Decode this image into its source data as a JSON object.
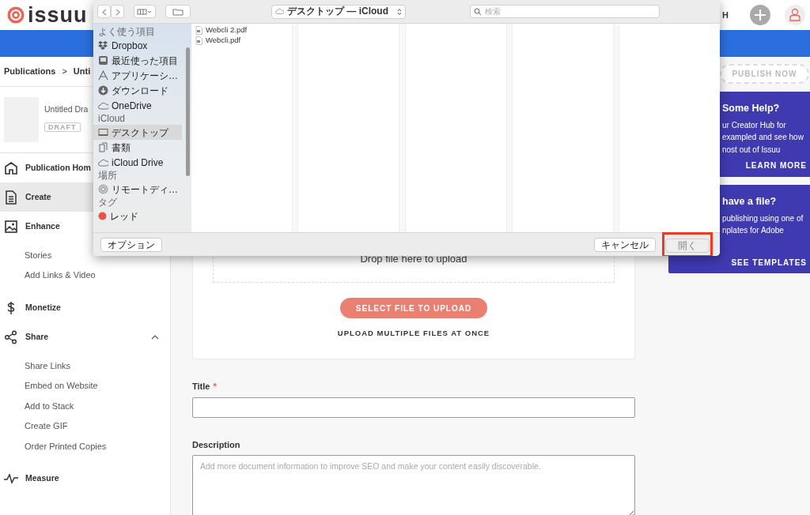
{
  "header": {
    "logo": "issuu",
    "nav_fragment": "H"
  },
  "breadcrumb": {
    "root": "Publications",
    "separator": ">",
    "current": "Unti"
  },
  "publication": {
    "title": "Untitled Dra",
    "status": "DRAFT"
  },
  "sidebar": {
    "items": [
      {
        "kind": "main",
        "label": "Publication Hom",
        "selected": false
      },
      {
        "kind": "main",
        "label": "Create",
        "selected": true
      },
      {
        "kind": "main",
        "label": "Enhance",
        "selected": false
      },
      {
        "kind": "sub",
        "label": "Stories",
        "selected": false
      },
      {
        "kind": "sub",
        "label": "Add Links & Video",
        "selected": false
      },
      {
        "kind": "main",
        "label": "Monetize",
        "selected": false
      },
      {
        "kind": "main",
        "label": "Share",
        "selected": false,
        "expanded": true
      },
      {
        "kind": "sub",
        "label": "Share Links",
        "selected": false
      },
      {
        "kind": "sub",
        "label": "Embed on Website",
        "selected": false
      },
      {
        "kind": "sub",
        "label": "Add to Stack",
        "selected": false
      },
      {
        "kind": "sub",
        "label": "Create GIF",
        "selected": false
      },
      {
        "kind": "sub",
        "label": "Order Printed Copies",
        "selected": false
      },
      {
        "kind": "main",
        "label": "Measure",
        "selected": false
      }
    ]
  },
  "upload": {
    "drop_text": "Drop file here to upload",
    "button": "SELECT FILE TO UPLOAD",
    "multi_link": "UPLOAD MULTIPLE FILES AT ONCE"
  },
  "form": {
    "required_mark": "*",
    "fields": [
      {
        "kind": "input",
        "label": "Title",
        "required": true
      },
      {
        "kind": "textarea",
        "label": "Description",
        "required": false,
        "placeholder": "Add more document information to improve SEO and make your content easily discoverable."
      }
    ]
  },
  "right_panel": {
    "publish_button": "PUBLISH NOW",
    "cards": [
      {
        "title": "Some Help?",
        "lines": [
          "ur Creator Hub for",
          "exampled and see how",
          "nost out of Issuu"
        ],
        "link": "LEARN MORE"
      },
      {
        "title": "have a file?",
        "lines": [
          "publishing using one of",
          "nplates for Adobe"
        ],
        "link": "SEE TEMPLATES"
      }
    ]
  },
  "dialog": {
    "location": "デスクトップ — iCloud",
    "search_placeholder": "検索",
    "sidebar": [
      {
        "kind": "heading",
        "label": "よく使う項目"
      },
      {
        "kind": "item",
        "label": "Dropbox",
        "selected": false
      },
      {
        "kind": "item",
        "label": "最近使った項目",
        "selected": false
      },
      {
        "kind": "item",
        "label": "アプリケーシ…",
        "selected": false
      },
      {
        "kind": "item",
        "label": "ダウンロード",
        "selected": false
      },
      {
        "kind": "item",
        "label": "OneDrive",
        "selected": false
      },
      {
        "kind": "heading",
        "label": "iCloud"
      },
      {
        "kind": "item",
        "label": "デスクトップ",
        "selected": true
      },
      {
        "kind": "item",
        "label": "書類",
        "selected": false
      },
      {
        "kind": "item",
        "label": "iCloud Drive",
        "selected": false
      },
      {
        "kind": "heading",
        "label": "場所"
      },
      {
        "kind": "item",
        "label": "リモートディ…",
        "selected": false
      },
      {
        "kind": "heading",
        "label": "タグ"
      },
      {
        "kind": "tag",
        "label": "レッド",
        "selected": false,
        "color": "#e8534a"
      }
    ],
    "files": [
      {
        "name": "Webcli 2.pdf",
        "selected": false
      },
      {
        "name": "Webcli.pdf",
        "selected": false
      }
    ],
    "buttons": [
      {
        "kind": "options",
        "label": "オプション",
        "disabled": false
      },
      {
        "kind": "cancel",
        "label": "キャンセル",
        "disabled": false
      },
      {
        "kind": "open",
        "label": "開く",
        "disabled": true,
        "highlighted": true
      }
    ]
  }
}
